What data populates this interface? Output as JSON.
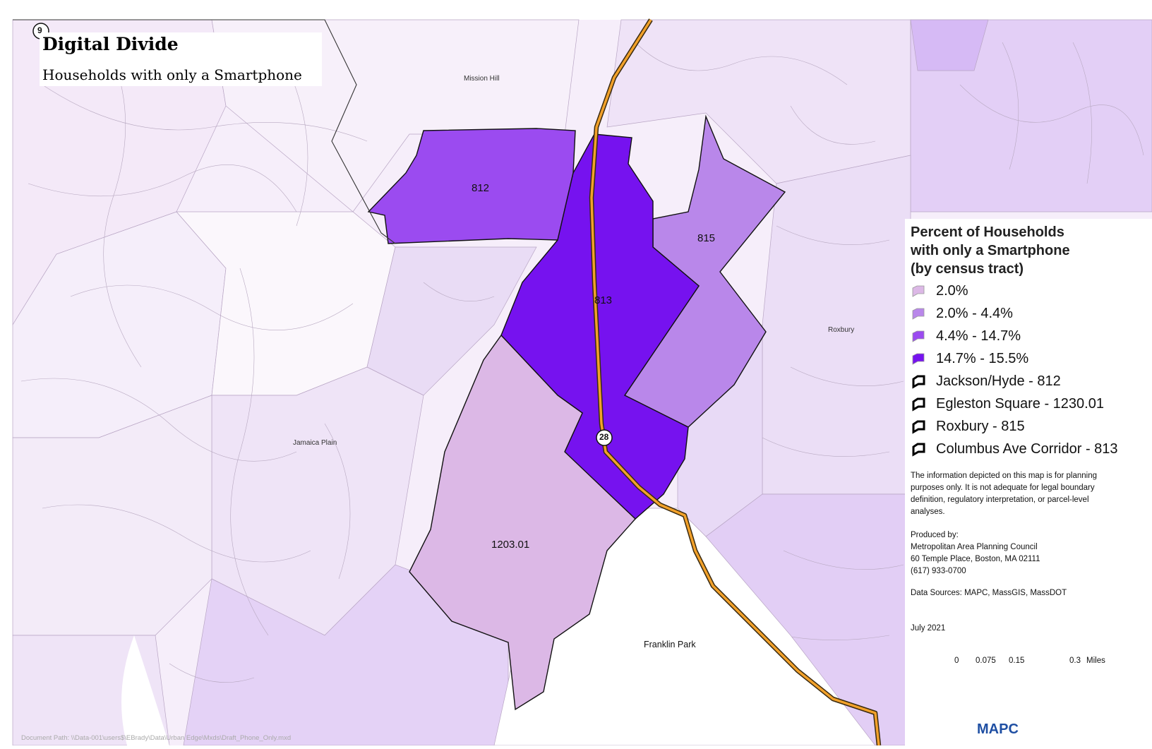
{
  "title": {
    "main": "Digital Divide",
    "subtitle": "Households with only a Smartphone"
  },
  "colors": {
    "class_1": "#dcb8e6",
    "class_2": "#b987ea",
    "class_3": "#9b4bf0",
    "class_4": "#7612ef",
    "background_tracts": "#eedff5"
  },
  "tracts": [
    {
      "id": "812",
      "label": "812",
      "class": "4.4% - 14.7%"
    },
    {
      "id": "813",
      "label": "813",
      "class": "14.7% - 15.5%"
    },
    {
      "id": "815",
      "label": "815",
      "class": "2.0% - 4.4%"
    },
    {
      "id": "1203.01",
      "label": "1203.01",
      "class": "2.0%"
    }
  ],
  "places": {
    "mission_hill": "Mission Hill",
    "jamaica_plain": "Jamaica Plain",
    "roxbury": "Roxbury",
    "franklin_park": "Franklin Park"
  },
  "routes": {
    "route_9": "9",
    "route_28": "28"
  },
  "legend": {
    "title": "Percent of Households\nwith only a Smartphone\n(by census tract)",
    "classes": [
      {
        "label": "2.0%",
        "color": "#dcb8e6"
      },
      {
        "label": "2.0% - 4.4%",
        "color": "#b987ea"
      },
      {
        "label": "4.4%  - 14.7%",
        "color": "#9b4bf0"
      },
      {
        "label": "14.7% - 15.5%",
        "color": "#7612ef"
      }
    ],
    "areas": [
      {
        "label": "Jackson/Hyde - 812"
      },
      {
        "label": "Egleston Square - 1230.01"
      },
      {
        "label": "Roxbury - 815"
      },
      {
        "label": "Columbus Ave Corridor - 813"
      }
    ]
  },
  "disclaimer": "The information depicted on this map is for planning\n purposes only. It is not adequate for legal boundary\ndefinition, regulatory interpretation, or parcel-level\nanalyses.",
  "producer": "Produced by:\nMetropolitan Area Planning Council\n60 Temple Place, Boston, MA 02111\n(617) 933-0700",
  "sources": "Data Sources: MAPC, MassGIS, MassDOT",
  "date": "July 2021",
  "scale": {
    "ticks": [
      "0",
      "0.075",
      "0.15",
      "0.3"
    ],
    "unit": "Miles"
  },
  "logo_text": "MAPC",
  "document_path": "Document Path: \\\\Data-001\\users$\\EBrady\\Data\\Urban Edge\\Mxds\\Draft_Phone_Only.mxd"
}
